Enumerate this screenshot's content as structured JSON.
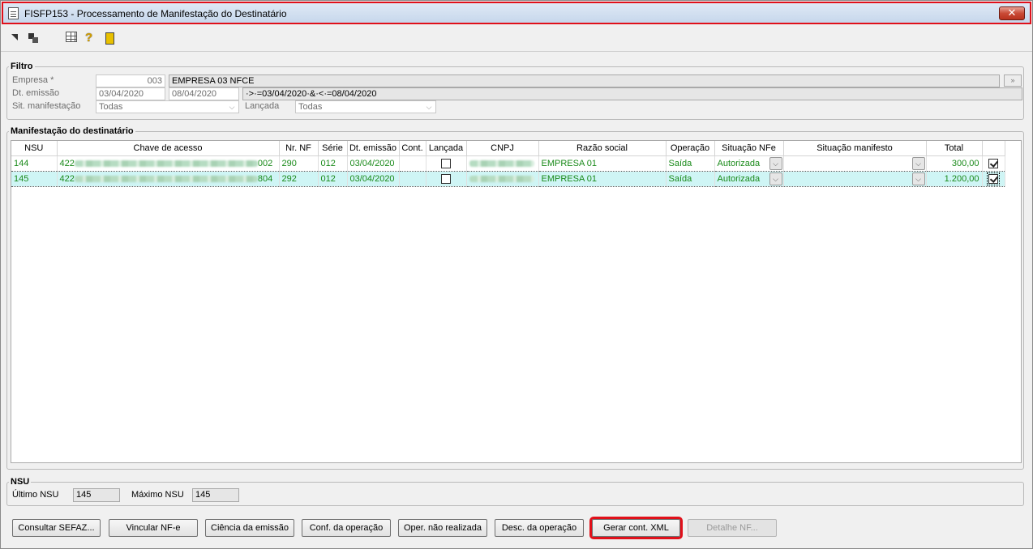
{
  "window": {
    "title": "FISFP153 - Processamento de Manifestação do Destinatário",
    "close_glyph": "✕"
  },
  "toolbar": {
    "icons": [
      "arrow-icon",
      "copy-icon",
      "calendar-grid-icon",
      "help-icon",
      "exit-door-icon"
    ],
    "help_glyph": "?"
  },
  "filter": {
    "legend": "Filtro",
    "empresa_label": "Empresa *",
    "empresa_code": "003",
    "empresa_name": "EMPRESA 03 NFCE",
    "lookup_glyph": "»",
    "dt_emissao_label": "Dt. emissão",
    "dt_from": "03/04/2020",
    "dt_to": "08/04/2020",
    "dt_expression": "·>·=03/04/2020·&·<·=08/04/2020",
    "sit_manifestacao_label": "Sit. manifestação",
    "sit_manifestacao_value": "Todas",
    "lancada_label": "Lançada",
    "lancada_value": "Todas",
    "arrow_glyph": "⌵"
  },
  "grid": {
    "legend": "Manifestação do destinatário",
    "columns": [
      "NSU",
      "Chave de acesso",
      "Nr. NF",
      "Série",
      "Dt. emissão",
      "Cont.",
      "Lançada",
      "CNPJ",
      "Razão social",
      "Operação",
      "Situação NFe",
      "Situação manifesto",
      "Total",
      ""
    ],
    "dd_glyph": "⌵",
    "rows": [
      {
        "nsu": "144",
        "chave_prefix": "422",
        "chave_suffix": "002",
        "nr_nf": "290",
        "serie": "012",
        "dt_emissao": "03/04/2020",
        "cont": "",
        "lancada": false,
        "razao_social": "EMPRESA 01",
        "operacao": "Saída",
        "situacao_nfe": "Autorizada",
        "situacao_manifesto": "",
        "total": "300,00",
        "selected_check": true
      },
      {
        "nsu": "145",
        "chave_prefix": "422",
        "chave_suffix": "804",
        "nr_nf": "292",
        "serie": "012",
        "dt_emissao": "03/04/2020",
        "cont": "",
        "lancada": false,
        "razao_social": "EMPRESA 01",
        "operacao": "Saída",
        "situacao_nfe": "Autorizada",
        "situacao_manifesto": "",
        "total": "1.200,00",
        "selected_check": true
      }
    ]
  },
  "nsu": {
    "legend": "NSU",
    "ultimo_label": "Último NSU",
    "ultimo_value": "145",
    "maximo_label": "Máximo NSU",
    "maximo_value": "145"
  },
  "buttons": {
    "consultar": "Consultar SEFAZ...",
    "vincular": "Vincular NF-e",
    "ciencia": "Ciência da emissão",
    "conf": "Conf. da operação",
    "oper_nao": "Oper. não realizada",
    "desc": "Desc. da operação",
    "gerar": "Gerar cont. XML",
    "detalhe": "Detalhe NF..."
  },
  "colors": {
    "highlight": "#e0101a",
    "row_text": "#1a8a1a",
    "selected_row": "#cff5f5"
  }
}
